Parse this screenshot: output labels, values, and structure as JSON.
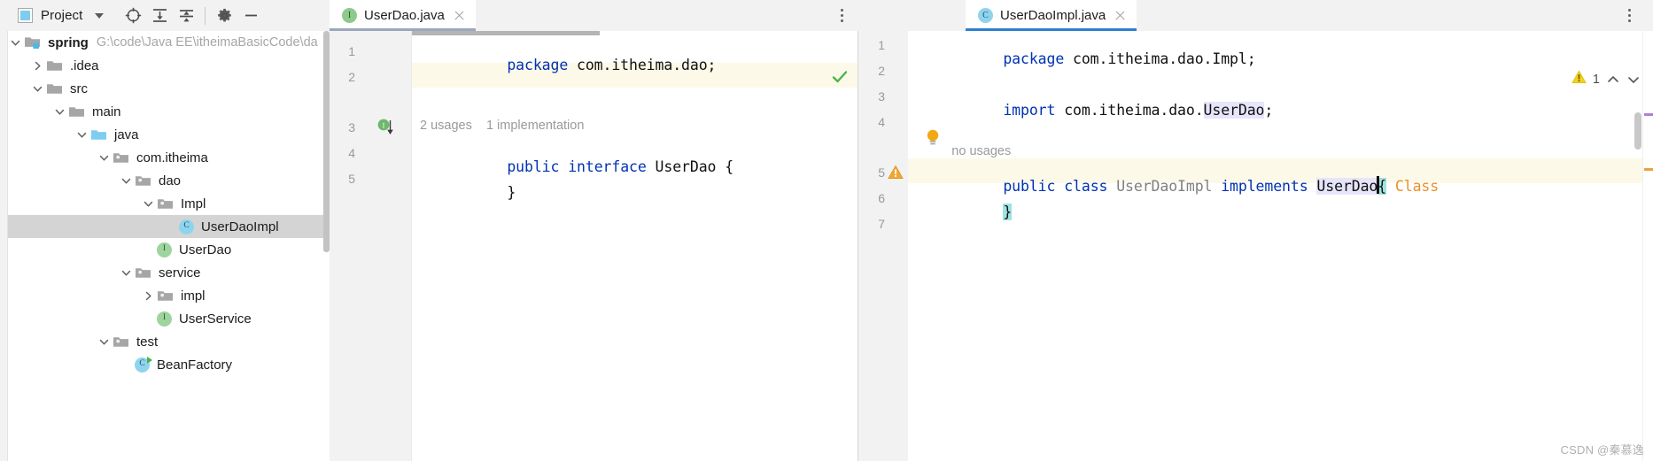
{
  "toolwindow": {
    "title": "Project",
    "icon": "project-icon",
    "dropdown_icon": "chevron-down-icon",
    "actions": [
      {
        "name": "select-opened-file-icon",
        "label": "Select Opened File"
      },
      {
        "name": "expand-all-icon",
        "label": "Expand All"
      },
      {
        "name": "collapse-all-icon",
        "label": "Collapse All"
      },
      {
        "name": "settings-gear-icon",
        "label": "Settings"
      },
      {
        "name": "hide-icon",
        "label": "Hide"
      }
    ]
  },
  "tree": {
    "items": [
      {
        "label": "spring",
        "path": "G:\\code\\Java EE\\itheimaBasicCode\\da",
        "icon": "module-folder-icon",
        "arrow": "expanded",
        "depth": 0,
        "bold": true,
        "selected": false
      },
      {
        "label": ".idea",
        "path": "",
        "icon": "folder-icon",
        "arrow": "collapsed",
        "depth": 1,
        "bold": false,
        "selected": false
      },
      {
        "label": "src",
        "path": "",
        "icon": "folder-icon",
        "arrow": "expanded",
        "depth": 1,
        "bold": false,
        "selected": false
      },
      {
        "label": "main",
        "path": "",
        "icon": "folder-icon",
        "arrow": "expanded",
        "depth": 2,
        "bold": false,
        "selected": false
      },
      {
        "label": "java",
        "path": "",
        "icon": "source-folder-icon",
        "arrow": "expanded",
        "depth": 3,
        "bold": false,
        "selected": false
      },
      {
        "label": "com.itheima",
        "path": "",
        "icon": "package-folder-icon",
        "arrow": "expanded",
        "depth": 4,
        "bold": false,
        "selected": false
      },
      {
        "label": "dao",
        "path": "",
        "icon": "package-folder-icon",
        "arrow": "expanded",
        "depth": 5,
        "bold": false,
        "selected": false
      },
      {
        "label": "Impl",
        "path": "",
        "icon": "package-folder-icon",
        "arrow": "expanded",
        "depth": 6,
        "bold": false,
        "selected": false
      },
      {
        "label": "UserDaoImpl",
        "path": "",
        "icon": "class-icon",
        "arrow": "none",
        "depth": 7,
        "bold": false,
        "selected": true
      },
      {
        "label": "UserDao",
        "path": "",
        "icon": "interface-icon",
        "arrow": "none",
        "depth": 6,
        "bold": false,
        "selected": false
      },
      {
        "label": "service",
        "path": "",
        "icon": "package-folder-icon",
        "arrow": "expanded",
        "depth": 5,
        "bold": false,
        "selected": false
      },
      {
        "label": "impl",
        "path": "",
        "icon": "package-folder-icon",
        "arrow": "collapsed",
        "depth": 6,
        "bold": false,
        "selected": false
      },
      {
        "label": "UserService",
        "path": "",
        "icon": "interface-icon",
        "arrow": "none",
        "depth": 6,
        "bold": false,
        "selected": false
      },
      {
        "label": "test",
        "path": "",
        "icon": "package-folder-icon",
        "arrow": "expanded",
        "depth": 4,
        "bold": false,
        "selected": false
      },
      {
        "label": "BeanFactory",
        "path": "",
        "icon": "runnable-class-icon",
        "arrow": "none",
        "depth": 5,
        "bold": false,
        "selected": false
      }
    ]
  },
  "left_editor": {
    "tab": {
      "label": "UserDao.java",
      "icon": "interface-icon",
      "close_icon": "close-icon"
    },
    "status_icon": "inspection-ok-check-icon",
    "line_numbers": [
      "1",
      "2",
      "3",
      "4",
      "5"
    ],
    "gutter_icons": [
      {
        "line": 3,
        "name": "implemented-by-icon"
      }
    ],
    "hints": [
      {
        "line": 3,
        "text": "2 usages    1 implementation"
      }
    ],
    "code": [
      {
        "line": 1,
        "tokens": [
          {
            "t": "package ",
            "c": "kw"
          },
          {
            "t": "com.itheima.dao;",
            "c": "plain"
          }
        ]
      },
      {
        "line": 2,
        "tokens": []
      },
      {
        "line": 3,
        "tokens": [
          {
            "t": "public ",
            "c": "kw"
          },
          {
            "t": "interface ",
            "c": "kw"
          },
          {
            "t": "UserDao {",
            "c": "plain"
          }
        ]
      },
      {
        "line": 4,
        "tokens": [
          {
            "t": "}",
            "c": "plain"
          }
        ]
      },
      {
        "line": 5,
        "tokens": []
      }
    ],
    "caret_line": 2
  },
  "right_editor": {
    "tab": {
      "label": "UserDaoImpl.java",
      "icon": "class-icon",
      "close_icon": "close-icon"
    },
    "kebab_icon": "more-options-icon",
    "inspections": {
      "warning_icon": "warning-triangle-icon",
      "count": "1",
      "prev_icon": "chevron-up-icon",
      "next_icon": "chevron-down-icon"
    },
    "line_numbers": [
      "1",
      "2",
      "3",
      "4",
      "5",
      "6",
      "7"
    ],
    "gutter_icons": [
      {
        "line": 5,
        "name": "warning-triangle-icon"
      },
      {
        "line": 5,
        "name": "intention-bulb-icon"
      }
    ],
    "hints": [
      {
        "line": 5,
        "text": "no usages"
      }
    ],
    "code": [
      {
        "line": 1,
        "tokens": [
          {
            "t": "package ",
            "c": "kw"
          },
          {
            "t": "com.itheima.dao.Impl;",
            "c": "plain"
          }
        ]
      },
      {
        "line": 2,
        "tokens": []
      },
      {
        "line": 3,
        "tokens": [
          {
            "t": "import ",
            "c": "kw"
          },
          {
            "t": "com.itheima.dao.",
            "c": "plain"
          },
          {
            "t": "UserDao",
            "c": "hl-lav"
          },
          {
            "t": ";",
            "c": "plain"
          }
        ]
      },
      {
        "line": 4,
        "tokens": []
      },
      {
        "line": 5,
        "tokens": [
          {
            "t": "public ",
            "c": "kw"
          },
          {
            "t": "class ",
            "c": "kw"
          },
          {
            "t": "UserDaoImpl",
            "c": "ident-gray"
          },
          {
            "t": " implements ",
            "c": "kw"
          },
          {
            "t": "UserDao",
            "c": "hl-lav"
          },
          {
            "t": "{",
            "c": "hl-cyan"
          },
          {
            "t": " Class",
            "c": "orange"
          }
        ]
      },
      {
        "line": 6,
        "tokens": [
          {
            "t": "}",
            "c": "hl-cyan"
          }
        ]
      },
      {
        "line": 7,
        "tokens": []
      }
    ],
    "caret_line": 5,
    "caret_after": "UserDao"
  },
  "watermark": "CSDN @秦慕逸"
}
